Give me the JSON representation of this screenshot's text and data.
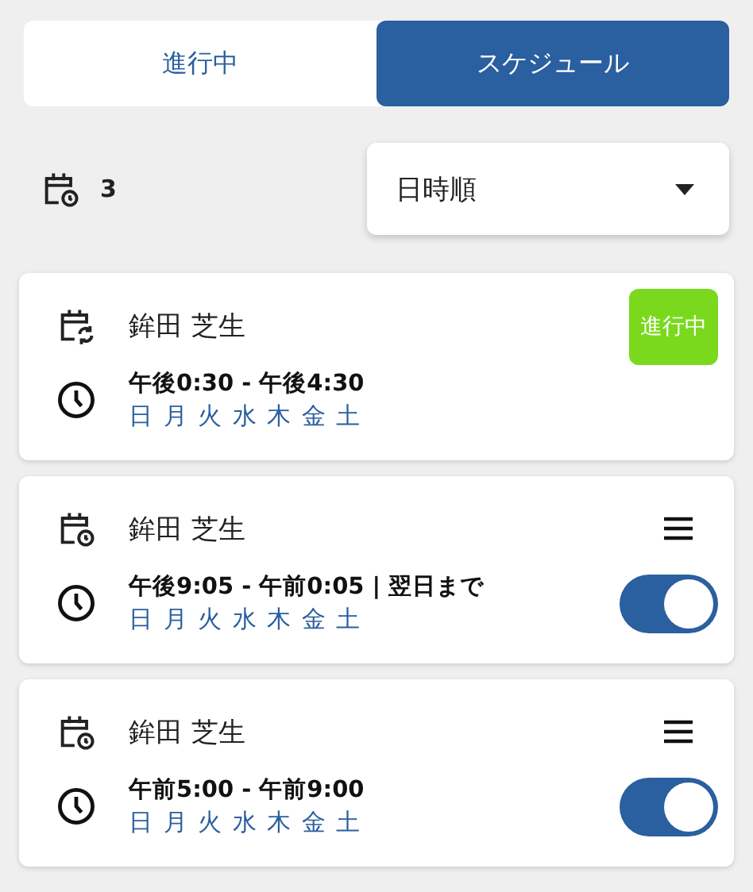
{
  "tabs": [
    {
      "label": "進行中",
      "selected": false
    },
    {
      "label": "スケジュール",
      "selected": true
    }
  ],
  "summary": {
    "count": "3"
  },
  "sort": {
    "value": "日時順"
  },
  "schedules": [
    {
      "kind": "running",
      "name": "鉾田 芝生",
      "time": "午後0:30 - 午後4:30",
      "days": "日 月 火 水 木 金 土",
      "badge": "進行中"
    },
    {
      "kind": "scheduled",
      "name": "鉾田 芝生",
      "time": "午後9:05 - 午前0:05 | 翌日まで",
      "days": "日 月 火 水 木 金 土",
      "on": true
    },
    {
      "kind": "scheduled",
      "name": "鉾田 芝生",
      "time": "午前5:00 - 午前9:00",
      "days": "日 月 火 水 木 金 土",
      "on": true
    }
  ]
}
